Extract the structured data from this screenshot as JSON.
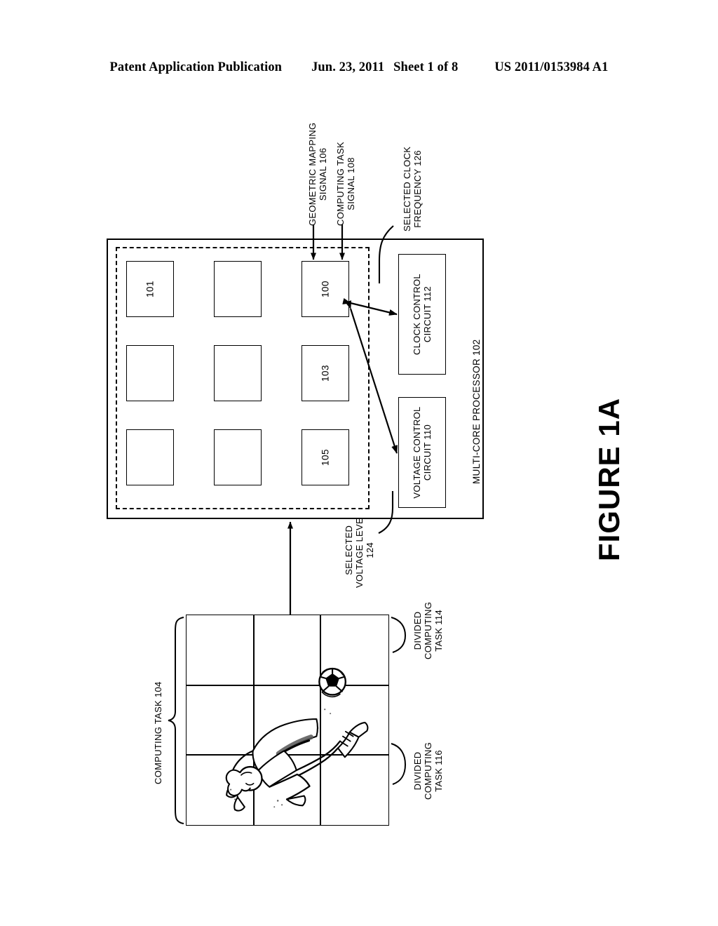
{
  "header": {
    "left": "Patent Application Publication",
    "date": "Jun. 23, 2011",
    "sheet": "Sheet 1 of 8",
    "number": "US 2011/0153984 A1"
  },
  "figure": {
    "caption": "FIGURE 1A"
  },
  "callouts": {
    "geometric_mapping_signal": "GEOMETRIC MAPPING\nSIGNAL 106",
    "geometric_mapping_signal_l1": "GEOMETRIC MAPPING",
    "geometric_mapping_signal_l2": "SIGNAL 106",
    "computing_task_signal_l1": "COMPUTING TASK",
    "computing_task_signal_l2": "SIGNAL 108",
    "selected_clock_frequency_l1": "SELECTED CLOCK",
    "selected_clock_frequency_l2": "FREQUENCY 126",
    "selected_voltage_level_l1": "SELECTED",
    "selected_voltage_level_l2": "VOLTAGE LEVEL",
    "selected_voltage_level_l3": "124",
    "computing_task_104": "COMPUTING TASK 104",
    "divided_computing_task_114_l1": "DIVIDED",
    "divided_computing_task_114_l2": "COMPUTING",
    "divided_computing_task_114_l3": "TASK 114",
    "divided_computing_task_116_l1": "DIVIDED",
    "divided_computing_task_116_l2": "COMPUTING",
    "divided_computing_task_116_l3": "TASK 116"
  },
  "processor": {
    "label": "MULTI-CORE PROCESSOR 102",
    "cores": [
      {
        "id": "r0c0",
        "label": "101"
      },
      {
        "id": "r0c1",
        "label": ""
      },
      {
        "id": "r0c2",
        "label": ""
      },
      {
        "id": "r1c0",
        "label": ""
      },
      {
        "id": "r1c1",
        "label": ""
      },
      {
        "id": "r1c2",
        "label": ""
      },
      {
        "id": "r2c0",
        "label": "100"
      },
      {
        "id": "r2c1",
        "label": "103"
      },
      {
        "id": "r2c2",
        "label": "105"
      }
    ],
    "clock_control": {
      "line1": "CLOCK CONTROL",
      "line2": "CIRCUIT 112"
    },
    "voltage_control": {
      "line1": "VOLTAGE CONTROL",
      "line2": "CIRCUIT 110"
    }
  },
  "task_image": {
    "grid_rows": 3,
    "grid_cols": 3,
    "content": "soccer-player-bicycle-kick-with-ball"
  },
  "colors": {
    "ink": "#000000",
    "paper": "#ffffff"
  }
}
